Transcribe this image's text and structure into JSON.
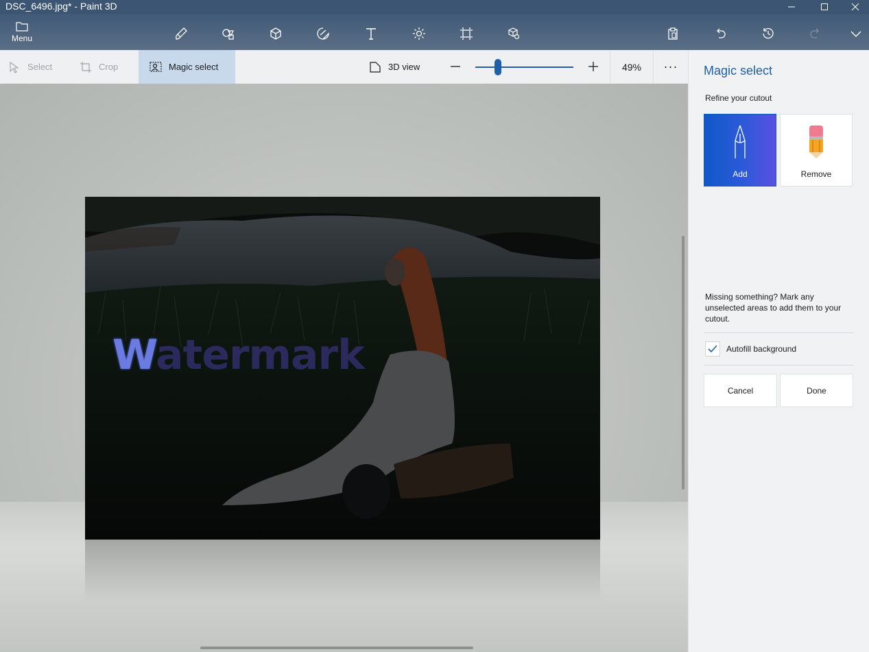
{
  "window": {
    "title": "DSC_6496.jpg* - Paint 3D",
    "controls": [
      "minimize-icon",
      "maximize-icon",
      "close-icon"
    ]
  },
  "toolbar": {
    "menu_label": "Menu",
    "tools": [
      "brushes-icon",
      "2d-shapes-icon",
      "3d-shapes-icon",
      "stickers-icon",
      "text-icon",
      "effects-icon",
      "canvas-icon",
      "3d-library-icon"
    ],
    "right_tools": [
      "paste-icon",
      "undo-icon",
      "history-icon",
      "redo-icon",
      "expand-icon"
    ]
  },
  "subbar": {
    "select_label": "Select",
    "crop_label": "Crop",
    "magic_select_label": "Magic select",
    "view3d_label": "3D view",
    "zoom_percent": "49%",
    "zoom_value": 0.2,
    "more_label": "···"
  },
  "canvas": {
    "watermark_text_first": "W",
    "watermark_text_rest": "atermark"
  },
  "panel": {
    "title": "Magic select",
    "subtitle": "Refine your cutout",
    "add_label": "Add",
    "remove_label": "Remove",
    "hint": "Missing something? Mark any unselected areas to add them to your cutout.",
    "autofill_label": "Autofill background",
    "autofill_checked": true,
    "cancel_label": "Cancel",
    "done_label": "Done"
  },
  "colors": {
    "accent": "#1f5fa8",
    "titlebar": "#3b5573",
    "add_tile_start": "#1058c8",
    "add_tile_end": "#5a4fe0"
  }
}
